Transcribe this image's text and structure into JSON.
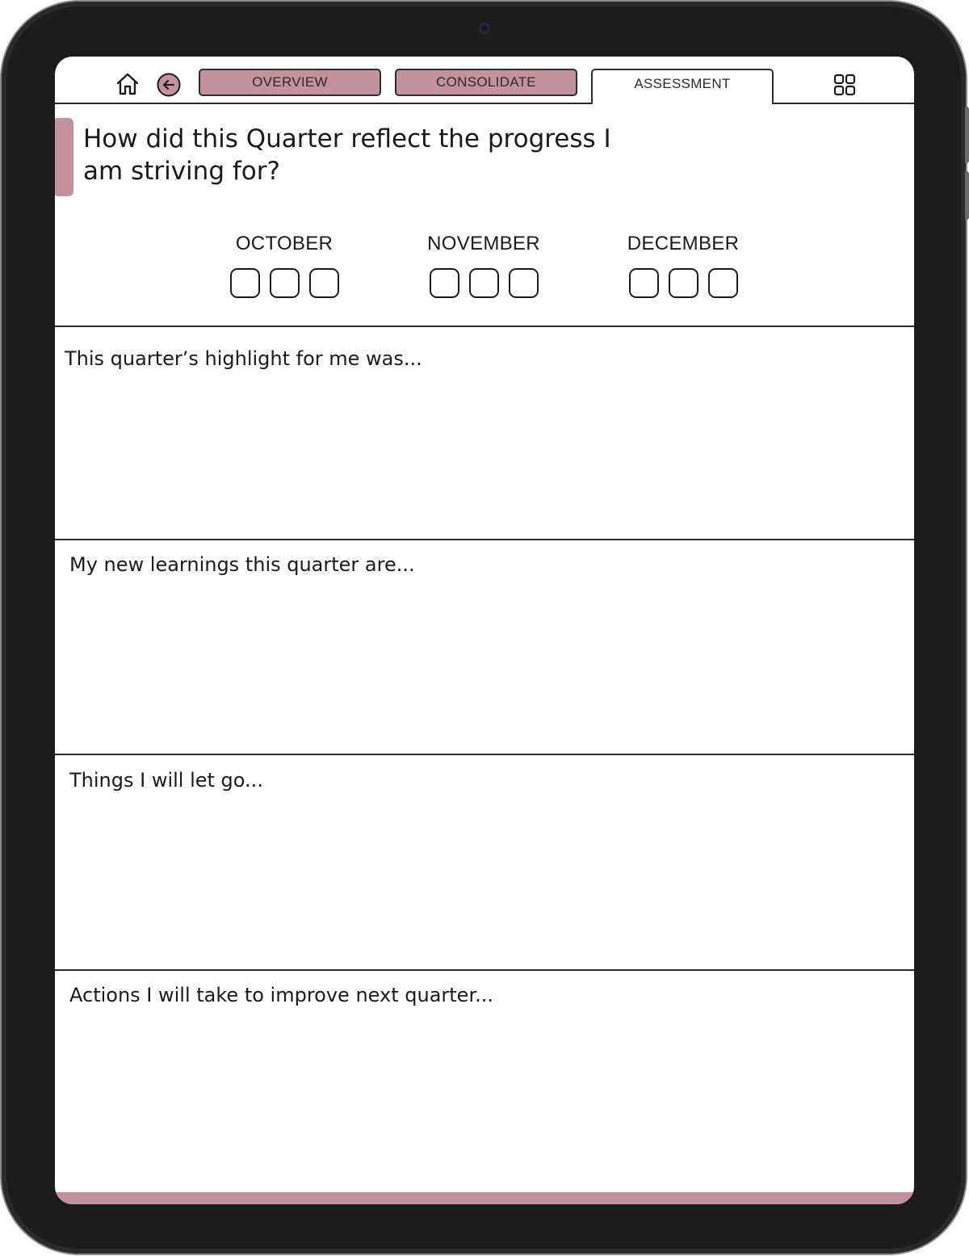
{
  "nav": {
    "tabs": [
      {
        "label": "OVERVIEW",
        "active": false
      },
      {
        "label": "CONSOLIDATE",
        "active": false
      },
      {
        "label": "ASSESSMENT",
        "active": true
      }
    ],
    "icons": {
      "home": "home-icon",
      "back": "back-arrow-icon",
      "grid": "grid-icon"
    }
  },
  "question": {
    "text": "How did this Quarter reflect the progress I am striving for?"
  },
  "months": [
    {
      "label": "OCTOBER",
      "boxes": 3
    },
    {
      "label": "NOVEMBER",
      "boxes": 3
    },
    {
      "label": "DECEMBER",
      "boxes": 3
    }
  ],
  "sections": [
    {
      "label": "This quarter’s highlight for me was..."
    },
    {
      "label": "My new learnings this quarter are..."
    },
    {
      "label": "Things I will let go..."
    },
    {
      "label": "Actions I will take to improve next quarter..."
    }
  ],
  "colors": {
    "accent": "#c4929d",
    "bezel": "#1c1c1d",
    "line": "#2d2d2d"
  }
}
